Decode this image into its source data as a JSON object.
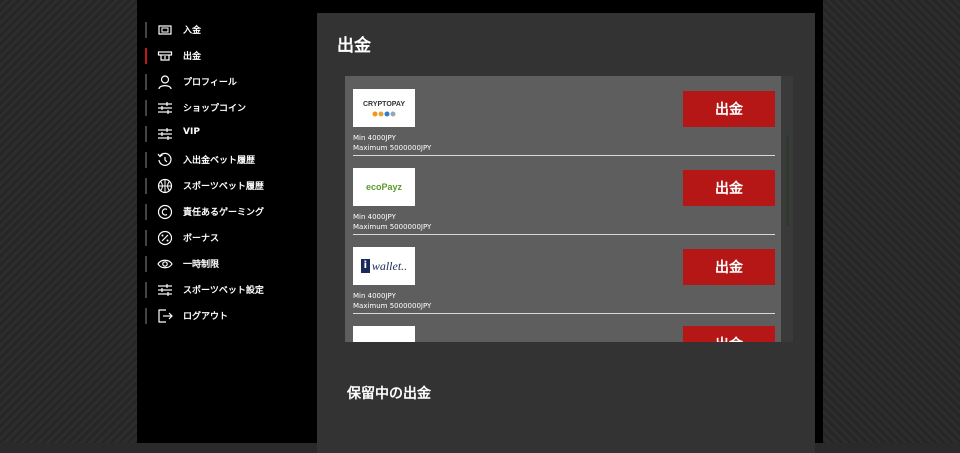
{
  "sidebar": {
    "items": [
      {
        "label": "入金",
        "icon": "wallet-icon",
        "active": false
      },
      {
        "label": "出金",
        "icon": "withdraw-icon",
        "active": true
      },
      {
        "label": "プロフィール",
        "icon": "user-icon",
        "active": false
      },
      {
        "label": "ショップコイン",
        "icon": "sliders-icon",
        "active": false
      },
      {
        "label": "VIP",
        "icon": "sliders-icon",
        "active": false
      },
      {
        "label": "入出金ベット履歴",
        "icon": "history-icon",
        "active": false
      },
      {
        "label": "スポーツベット履歴",
        "icon": "ball-icon",
        "active": false
      },
      {
        "label": "責任あるゲーミング",
        "icon": "responsible-gaming-icon",
        "active": false
      },
      {
        "label": "ボーナス",
        "icon": "percent-icon",
        "active": false
      },
      {
        "label": "一時制限",
        "icon": "eye-icon",
        "active": false
      },
      {
        "label": "スポーツベット設定",
        "icon": "sliders-icon",
        "active": false
      },
      {
        "label": "ログアウト",
        "icon": "logout-icon",
        "active": false
      }
    ]
  },
  "main": {
    "title": "出金",
    "methods": [
      {
        "logo_text": "CRYPTOPAY",
        "min": "Min 4000JPY",
        "max": "Maximum 5000000JPY",
        "button": "出金"
      },
      {
        "logo_text": "ecoPayz",
        "min": "Min 4000JPY",
        "max": "Maximum 5000000JPY",
        "button": "出金"
      },
      {
        "logo_text": "wallet..",
        "min": "Min 4000JPY",
        "max": "Maximum 5000000JPY",
        "button": "出金"
      },
      {
        "logo_text": "",
        "min": "",
        "max": "",
        "button": "出金"
      }
    ],
    "pending_title": "保留中の出金"
  },
  "colors": {
    "accent": "#b51616",
    "panel": "#333333",
    "list_bg": "#5e5e5e"
  }
}
